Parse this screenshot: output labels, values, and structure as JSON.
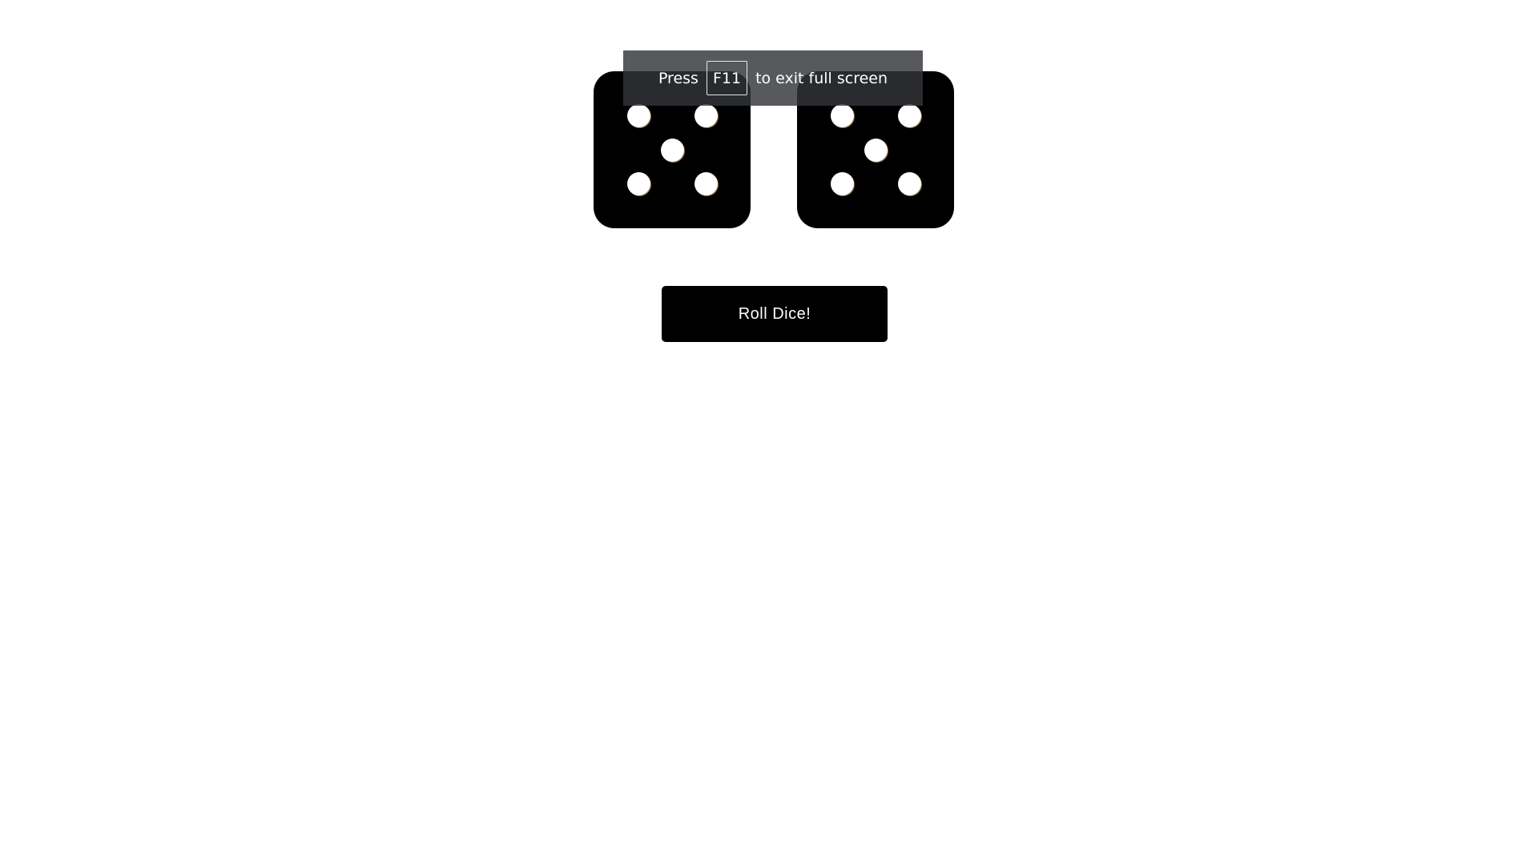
{
  "dice": [
    {
      "value": 5
    },
    {
      "value": 5
    }
  ],
  "roll_button": {
    "label": "Roll Dice!"
  },
  "fullscreen_banner": {
    "prefix": "Press",
    "key": "F11",
    "suffix": "to exit full screen"
  },
  "colors": {
    "background": "#ffffff",
    "die": "#000000",
    "pip": "#ffffff",
    "button": "#000000",
    "button_text": "#ffffff",
    "banner": "#323438"
  }
}
